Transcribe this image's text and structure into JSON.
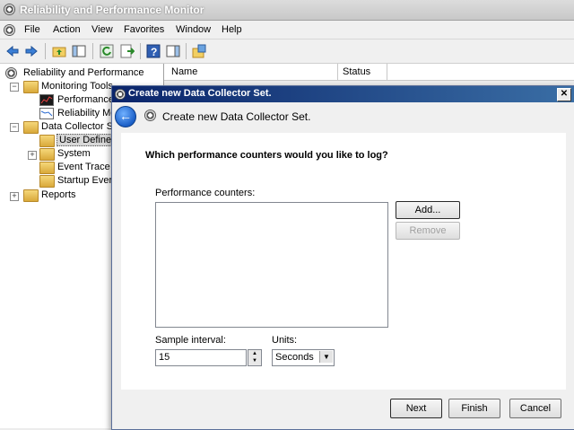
{
  "window": {
    "title": "Reliability and Performance Monitor"
  },
  "menu": [
    "File",
    "Action",
    "View",
    "Favorites",
    "Window",
    "Help"
  ],
  "tree": {
    "root": "Reliability and Performance",
    "monitoring_tools": "Monitoring Tools",
    "performance": "Performance",
    "reliability": "Reliability Mo",
    "data_collector": "Data Collector Se",
    "user_defined": "User Defined",
    "system": "System",
    "event_trace": "Event Trace",
    "startup_event": "Startup Ever",
    "reports": "Reports"
  },
  "list": {
    "columns": [
      "Name",
      "Status"
    ]
  },
  "dialog": {
    "title": "Create new Data Collector Set.",
    "header": "Create new Data Collector Set.",
    "question": "Which performance counters would you like to log?",
    "counters_label": "Performance counters:",
    "add_label": "Add...",
    "remove_label": "Remove",
    "sample_interval_label": "Sample interval:",
    "sample_interval_value": "15",
    "units_label": "Units:",
    "units_value": "Seconds",
    "next_label": "Next",
    "finish_label": "Finish",
    "cancel_label": "Cancel"
  }
}
